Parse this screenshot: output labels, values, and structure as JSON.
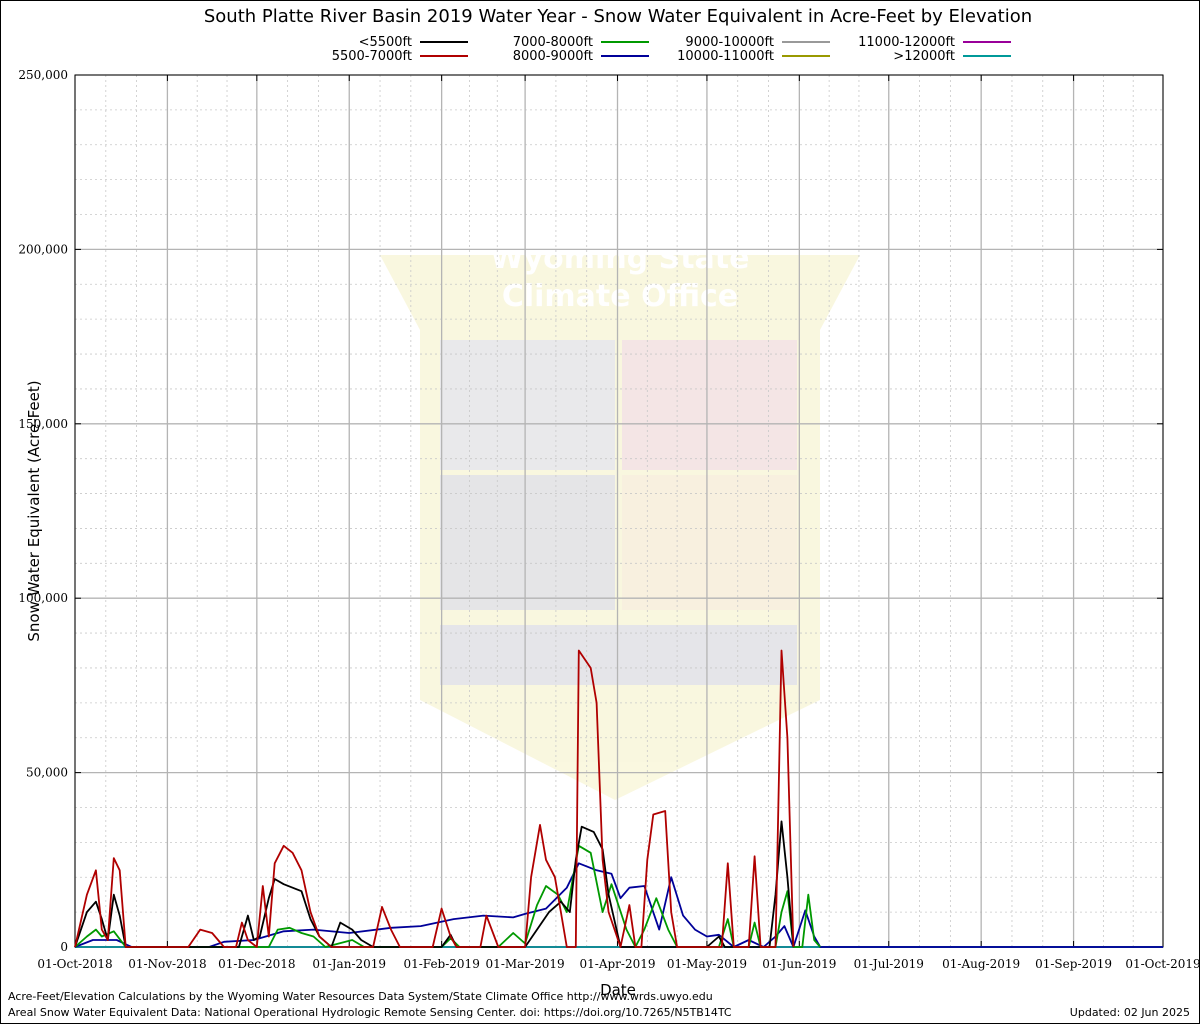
{
  "chart_data": {
    "type": "line",
    "title": "South Platte River Basin 2019 Water Year - Snow Water Equivalent in Acre-Feet by Elevation",
    "xlabel": "Date",
    "ylabel": "Snow Water Equivalent (Acre-Feet)",
    "ylim": [
      0,
      250000
    ],
    "yticks": [
      0,
      50000,
      100000,
      150000,
      200000,
      250000
    ],
    "ytick_labels": [
      "0",
      "50,000",
      "100,000",
      "150,000",
      "200,000",
      "250,000"
    ],
    "xlim": [
      "2018-10-01",
      "2019-10-01"
    ],
    "xticks": [
      "2018-10-01",
      "2018-11-01",
      "2018-12-01",
      "2019-01-01",
      "2019-02-01",
      "2019-03-01",
      "2019-04-01",
      "2019-05-01",
      "2019-06-01",
      "2019-07-01",
      "2019-08-01",
      "2019-09-01",
      "2019-10-01"
    ],
    "xtick_labels": [
      "01-Oct-2018",
      "01-Nov-2018",
      "01-Dec-2018",
      "01-Jan-2019",
      "01-Feb-2019",
      "01-Mar-2019",
      "01-Apr-2019",
      "01-May-2019",
      "01-Jun-2019",
      "01-Jul-2019",
      "01-Aug-2019",
      "01-Sep-2019",
      "01-Oct-2019"
    ],
    "grid": true,
    "legend_position": "top",
    "series": [
      {
        "name": "<5500ft",
        "color": "#000000",
        "points": [
          [
            "2018-10-01",
            0
          ],
          [
            "2018-10-05",
            10000
          ],
          [
            "2018-10-08",
            13000
          ],
          [
            "2018-10-10",
            8000
          ],
          [
            "2018-10-12",
            2000
          ],
          [
            "2018-10-14",
            15000
          ],
          [
            "2018-10-16",
            9000
          ],
          [
            "2018-10-18",
            0
          ],
          [
            "2018-11-25",
            0
          ],
          [
            "2018-11-28",
            9000
          ],
          [
            "2018-11-30",
            2000
          ],
          [
            "2018-12-02",
            3000
          ],
          [
            "2018-12-05",
            14000
          ],
          [
            "2018-12-07",
            19500
          ],
          [
            "2018-12-10",
            18000
          ],
          [
            "2018-12-13",
            17000
          ],
          [
            "2018-12-16",
            16000
          ],
          [
            "2018-12-19",
            8000
          ],
          [
            "2018-12-22",
            3000
          ],
          [
            "2018-12-26",
            0
          ],
          [
            "2018-12-29",
            7000
          ],
          [
            "2019-01-02",
            5000
          ],
          [
            "2019-01-05",
            2000
          ],
          [
            "2019-01-09",
            0
          ],
          [
            "2019-02-01",
            0
          ],
          [
            "2019-02-04",
            3500
          ],
          [
            "2019-02-06",
            0
          ],
          [
            "2019-03-01",
            0
          ],
          [
            "2019-03-05",
            5000
          ],
          [
            "2019-03-09",
            10000
          ],
          [
            "2019-03-13",
            13000
          ],
          [
            "2019-03-16",
            10000
          ],
          [
            "2019-03-18",
            25000
          ],
          [
            "2019-03-20",
            34500
          ],
          [
            "2019-03-24",
            33000
          ],
          [
            "2019-03-27",
            28000
          ],
          [
            "2019-03-29",
            15000
          ],
          [
            "2019-04-02",
            0
          ],
          [
            "2019-05-01",
            0
          ],
          [
            "2019-05-05",
            3000
          ],
          [
            "2019-05-07",
            0
          ],
          [
            "2019-05-22",
            0
          ],
          [
            "2019-05-24",
            15000
          ],
          [
            "2019-05-26",
            36000
          ],
          [
            "2019-05-28",
            20000
          ],
          [
            "2019-05-30",
            0
          ]
        ]
      },
      {
        "name": "5500-7000ft",
        "color": "#b00000",
        "points": [
          [
            "2018-10-01",
            0
          ],
          [
            "2018-10-05",
            15000
          ],
          [
            "2018-10-08",
            22000
          ],
          [
            "2018-10-10",
            5000
          ],
          [
            "2018-10-12",
            2000
          ],
          [
            "2018-10-14",
            25500
          ],
          [
            "2018-10-16",
            22000
          ],
          [
            "2018-10-18",
            0
          ],
          [
            "2018-11-08",
            0
          ],
          [
            "2018-11-12",
            5000
          ],
          [
            "2018-11-16",
            4000
          ],
          [
            "2018-11-20",
            0
          ],
          [
            "2018-11-24",
            0
          ],
          [
            "2018-11-26",
            7000
          ],
          [
            "2018-11-28",
            2000
          ],
          [
            "2018-12-01",
            0
          ],
          [
            "2018-12-03",
            17500
          ],
          [
            "2018-12-05",
            3000
          ],
          [
            "2018-12-07",
            24000
          ],
          [
            "2018-12-10",
            29000
          ],
          [
            "2018-12-13",
            27000
          ],
          [
            "2018-12-16",
            22000
          ],
          [
            "2018-12-19",
            10000
          ],
          [
            "2018-12-22",
            3000
          ],
          [
            "2018-12-26",
            0
          ],
          [
            "2019-01-09",
            0
          ],
          [
            "2019-01-12",
            11500
          ],
          [
            "2019-01-15",
            5000
          ],
          [
            "2019-01-18",
            0
          ],
          [
            "2019-01-29",
            0
          ],
          [
            "2019-02-01",
            11000
          ],
          [
            "2019-02-04",
            3000
          ],
          [
            "2019-02-06",
            0
          ],
          [
            "2019-02-14",
            0
          ],
          [
            "2019-02-16",
            9000
          ],
          [
            "2019-02-20",
            0
          ],
          [
            "2019-03-01",
            0
          ],
          [
            "2019-03-03",
            20000
          ],
          [
            "2019-03-06",
            35000
          ],
          [
            "2019-03-08",
            25000
          ],
          [
            "2019-03-11",
            20000
          ],
          [
            "2019-03-13",
            10000
          ],
          [
            "2019-03-15",
            0
          ],
          [
            "2019-03-18",
            0
          ],
          [
            "2019-03-19",
            85000
          ],
          [
            "2019-03-23",
            80000
          ],
          [
            "2019-03-25",
            70000
          ],
          [
            "2019-03-27",
            25000
          ],
          [
            "2019-03-29",
            10000
          ],
          [
            "2019-04-02",
            0
          ],
          [
            "2019-04-05",
            12000
          ],
          [
            "2019-04-07",
            0
          ],
          [
            "2019-04-09",
            0
          ],
          [
            "2019-04-11",
            25000
          ],
          [
            "2019-04-13",
            38000
          ],
          [
            "2019-04-17",
            39000
          ],
          [
            "2019-04-19",
            10000
          ],
          [
            "2019-04-21",
            0
          ],
          [
            "2019-05-06",
            0
          ],
          [
            "2019-05-08",
            24000
          ],
          [
            "2019-05-10",
            0
          ],
          [
            "2019-05-15",
            0
          ],
          [
            "2019-05-17",
            26000
          ],
          [
            "2019-05-19",
            0
          ],
          [
            "2019-05-24",
            0
          ],
          [
            "2019-05-26",
            85000
          ],
          [
            "2019-05-28",
            60000
          ],
          [
            "2019-05-30",
            0
          ]
        ]
      },
      {
        "name": "7000-8000ft",
        "color": "#009900",
        "points": [
          [
            "2018-10-01",
            0
          ],
          [
            "2018-10-05",
            3000
          ],
          [
            "2018-10-08",
            5000
          ],
          [
            "2018-10-10",
            3000
          ],
          [
            "2018-10-14",
            4500
          ],
          [
            "2018-10-18",
            0
          ],
          [
            "2018-12-05",
            0
          ],
          [
            "2018-12-08",
            5000
          ],
          [
            "2018-12-12",
            5500
          ],
          [
            "2018-12-16",
            4000
          ],
          [
            "2018-12-20",
            3000
          ],
          [
            "2018-12-24",
            0
          ],
          [
            "2019-01-02",
            2000
          ],
          [
            "2019-01-06",
            0
          ],
          [
            "2019-02-01",
            0
          ],
          [
            "2019-02-04",
            2500
          ],
          [
            "2019-02-07",
            0
          ],
          [
            "2019-02-20",
            0
          ],
          [
            "2019-02-25",
            4000
          ],
          [
            "2019-03-01",
            1000
          ],
          [
            "2019-03-05",
            12000
          ],
          [
            "2019-03-08",
            17500
          ],
          [
            "2019-03-12",
            15000
          ],
          [
            "2019-03-15",
            10000
          ],
          [
            "2019-03-19",
            29000
          ],
          [
            "2019-03-23",
            27000
          ],
          [
            "2019-03-27",
            10000
          ],
          [
            "2019-03-30",
            18000
          ],
          [
            "2019-04-04",
            5000
          ],
          [
            "2019-04-07",
            0
          ],
          [
            "2019-04-10",
            5000
          ],
          [
            "2019-04-14",
            14000
          ],
          [
            "2019-04-18",
            5000
          ],
          [
            "2019-04-21",
            0
          ],
          [
            "2019-05-05",
            0
          ],
          [
            "2019-05-08",
            8000
          ],
          [
            "2019-05-10",
            0
          ],
          [
            "2019-05-15",
            0
          ],
          [
            "2019-05-17",
            7000
          ],
          [
            "2019-05-19",
            0
          ],
          [
            "2019-05-24",
            0
          ],
          [
            "2019-05-26",
            10000
          ],
          [
            "2019-05-28",
            16000
          ],
          [
            "2019-05-30",
            0
          ],
          [
            "2019-06-02",
            0
          ],
          [
            "2019-06-04",
            15000
          ],
          [
            "2019-06-06",
            2000
          ],
          [
            "2019-06-08",
            0
          ]
        ]
      },
      {
        "name": "8000-9000ft",
        "color": "#000099",
        "points": [
          [
            "2018-10-01",
            0
          ],
          [
            "2018-10-07",
            2000
          ],
          [
            "2018-10-15",
            2000
          ],
          [
            "2018-10-20",
            0
          ],
          [
            "2018-11-15",
            0
          ],
          [
            "2018-11-20",
            1500
          ],
          [
            "2018-11-30",
            2000
          ],
          [
            "2018-12-10",
            4500
          ],
          [
            "2018-12-20",
            5000
          ],
          [
            "2019-01-01",
            4000
          ],
          [
            "2019-01-15",
            5500
          ],
          [
            "2019-01-25",
            6000
          ],
          [
            "2019-02-05",
            8000
          ],
          [
            "2019-02-15",
            9000
          ],
          [
            "2019-02-25",
            8500
          ],
          [
            "2019-03-01",
            9500
          ],
          [
            "2019-03-08",
            11000
          ],
          [
            "2019-03-15",
            17000
          ],
          [
            "2019-03-19",
            24000
          ],
          [
            "2019-03-25",
            22000
          ],
          [
            "2019-03-30",
            21000
          ],
          [
            "2019-04-02",
            14000
          ],
          [
            "2019-04-05",
            17000
          ],
          [
            "2019-04-10",
            17500
          ],
          [
            "2019-04-15",
            5000
          ],
          [
            "2019-04-19",
            20000
          ],
          [
            "2019-04-23",
            9000
          ],
          [
            "2019-04-27",
            5000
          ],
          [
            "2019-05-01",
            3000
          ],
          [
            "2019-05-05",
            3500
          ],
          [
            "2019-05-10",
            0
          ],
          [
            "2019-05-15",
            2000
          ],
          [
            "2019-05-20",
            0
          ],
          [
            "2019-05-24",
            3000
          ],
          [
            "2019-05-27",
            6000
          ],
          [
            "2019-05-30",
            0
          ],
          [
            "2019-06-03",
            10500
          ],
          [
            "2019-06-06",
            3000
          ],
          [
            "2019-06-08",
            0
          ],
          [
            "2019-07-01",
            0
          ],
          [
            "2019-10-01",
            0
          ]
        ]
      },
      {
        "name": "9000-10000ft",
        "color": "#999999",
        "points": [
          [
            "2018-10-01",
            0
          ],
          [
            "2019-10-01",
            0
          ]
        ]
      },
      {
        "name": "10000-11000ft",
        "color": "#999900",
        "points": [
          [
            "2018-10-01",
            0
          ],
          [
            "2019-10-01",
            0
          ]
        ]
      },
      {
        "name": "11000-12000ft",
        "color": "#990099",
        "points": [
          [
            "2018-10-01",
            0
          ],
          [
            "2019-10-01",
            0
          ]
        ]
      },
      {
        "name": ">12000ft",
        "color": "#009999",
        "points": [
          [
            "2018-10-01",
            0
          ],
          [
            "2019-10-01",
            0
          ]
        ]
      }
    ]
  },
  "watermark": {
    "line1": "Wyoming State",
    "line2": "Climate Office"
  },
  "footer": {
    "credit_1": "Acre-Feet/Elevation Calculations by the Wyoming Water Resources Data System/State Climate Office http://www.wrds.uwyo.edu",
    "credit_2": "Areal Snow Water Equivalent Data: National Operational Hydrologic Remote Sensing Center. doi: https://doi.org/10.7265/N5TB14TC",
    "updated": "Updated: 02 Jun 2025"
  }
}
